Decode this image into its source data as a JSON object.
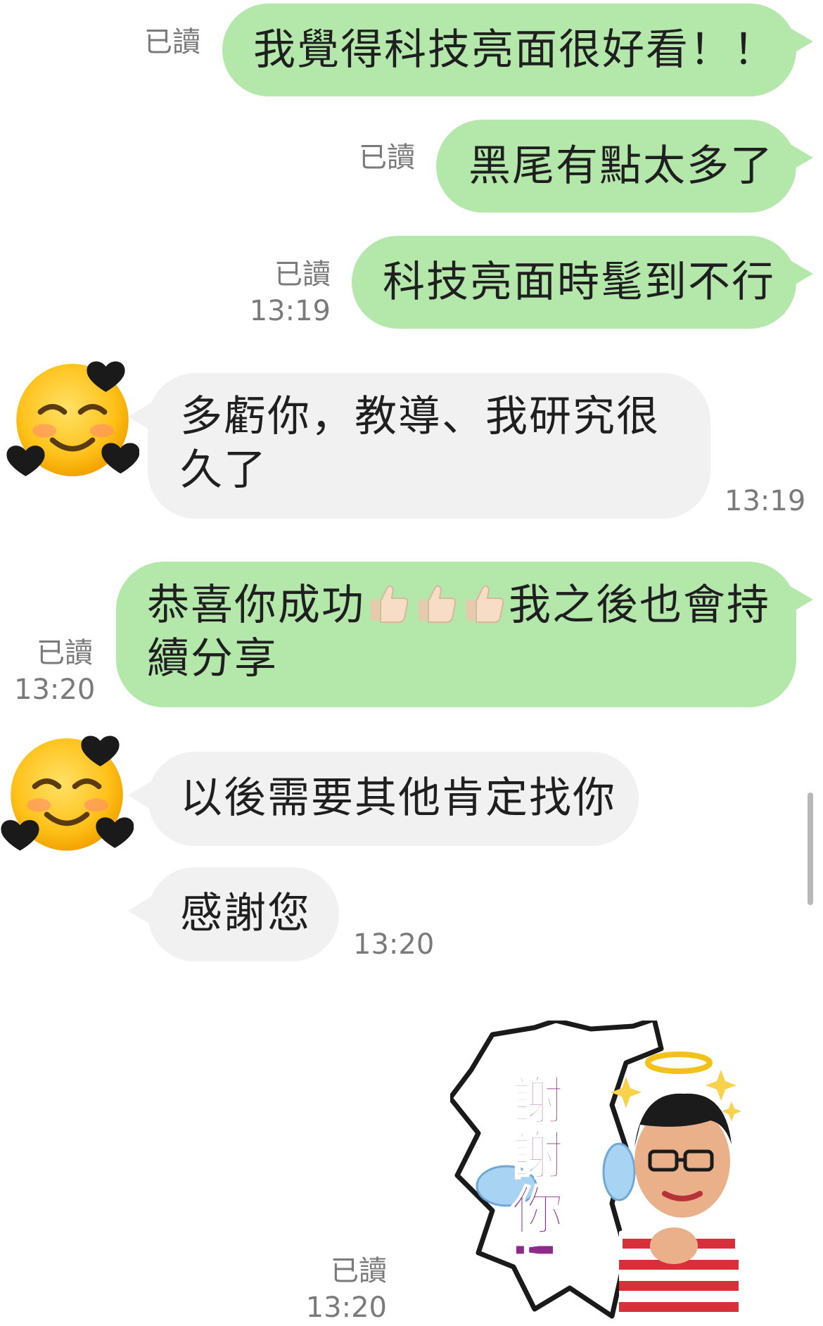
{
  "messages": [
    {
      "id": "m1",
      "side": "sent",
      "text": "我覺得科技亮面很好看！！",
      "read": "已讀"
    },
    {
      "id": "m2",
      "side": "sent",
      "text": "黑尾有點太多了",
      "read": "已讀"
    },
    {
      "id": "m3",
      "side": "sent",
      "text": "科技亮面時髦到不行",
      "read": "已讀",
      "time": "13:19"
    },
    {
      "id": "m4",
      "side": "received",
      "line1": "多虧你，教導、我研究很",
      "line2": "久了",
      "time": "13:19"
    },
    {
      "id": "m5",
      "side": "sent",
      "line1_a": "恭喜你成功",
      "line1_b": "我之後也會持",
      "line2": "續分享",
      "read": "已讀",
      "time": "13:20"
    },
    {
      "id": "m6",
      "side": "received",
      "text": "以後需要其他肯定找你"
    },
    {
      "id": "m7",
      "side": "received",
      "text": "感謝您",
      "time": "13:20"
    },
    {
      "id": "m8",
      "side": "sent",
      "type": "sticker",
      "sticker_text": "謝謝你!",
      "read": "已讀",
      "time": "13:20"
    }
  ],
  "colors": {
    "sent_bubble": "#b4e8ab",
    "received_bubble": "#f1f1f1",
    "meta_text": "#7a7a7a",
    "sticker_text": "#8e2a8a"
  },
  "icons": {
    "avatar": "smiling-face-with-hearts-icon",
    "thumbs_up": "thumbs-up-icon"
  }
}
